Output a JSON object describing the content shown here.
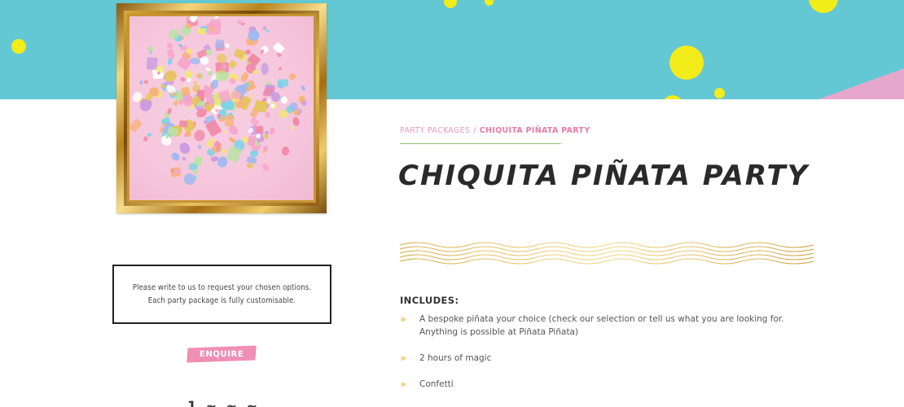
{
  "breadcrumb": {
    "parent": "PARTY PACKAGES",
    "separator": "/",
    "current": "CHIQUITA PIÑATA PARTY"
  },
  "page_title": "CHIQUITA PIÑATA PARTY",
  "notice": {
    "line1": "Please write to us to request your chosen options.",
    "line2": "Each party package is fully customisable."
  },
  "enquire_label": "ENQUIRE",
  "partial_text": "1 ~ ~ ~",
  "includes": {
    "heading": "INCLUDES:",
    "items": [
      "A bespoke piñata your choice (check our selection or tell us what you are looking for. Anything is possible at Piñata Piñata)",
      "2 hours of magic",
      "Confetti"
    ]
  },
  "colors": {
    "banner": "#63c8d3",
    "dots": "#f3ec1b",
    "pink_accent": "#e99bbd",
    "enquire_bg": "#ef8fb6",
    "breadcrumb_rule": "#8cc56e",
    "gold": "#e8c469"
  },
  "icons": {
    "list_bullet": "double-chevron-right-icon"
  }
}
